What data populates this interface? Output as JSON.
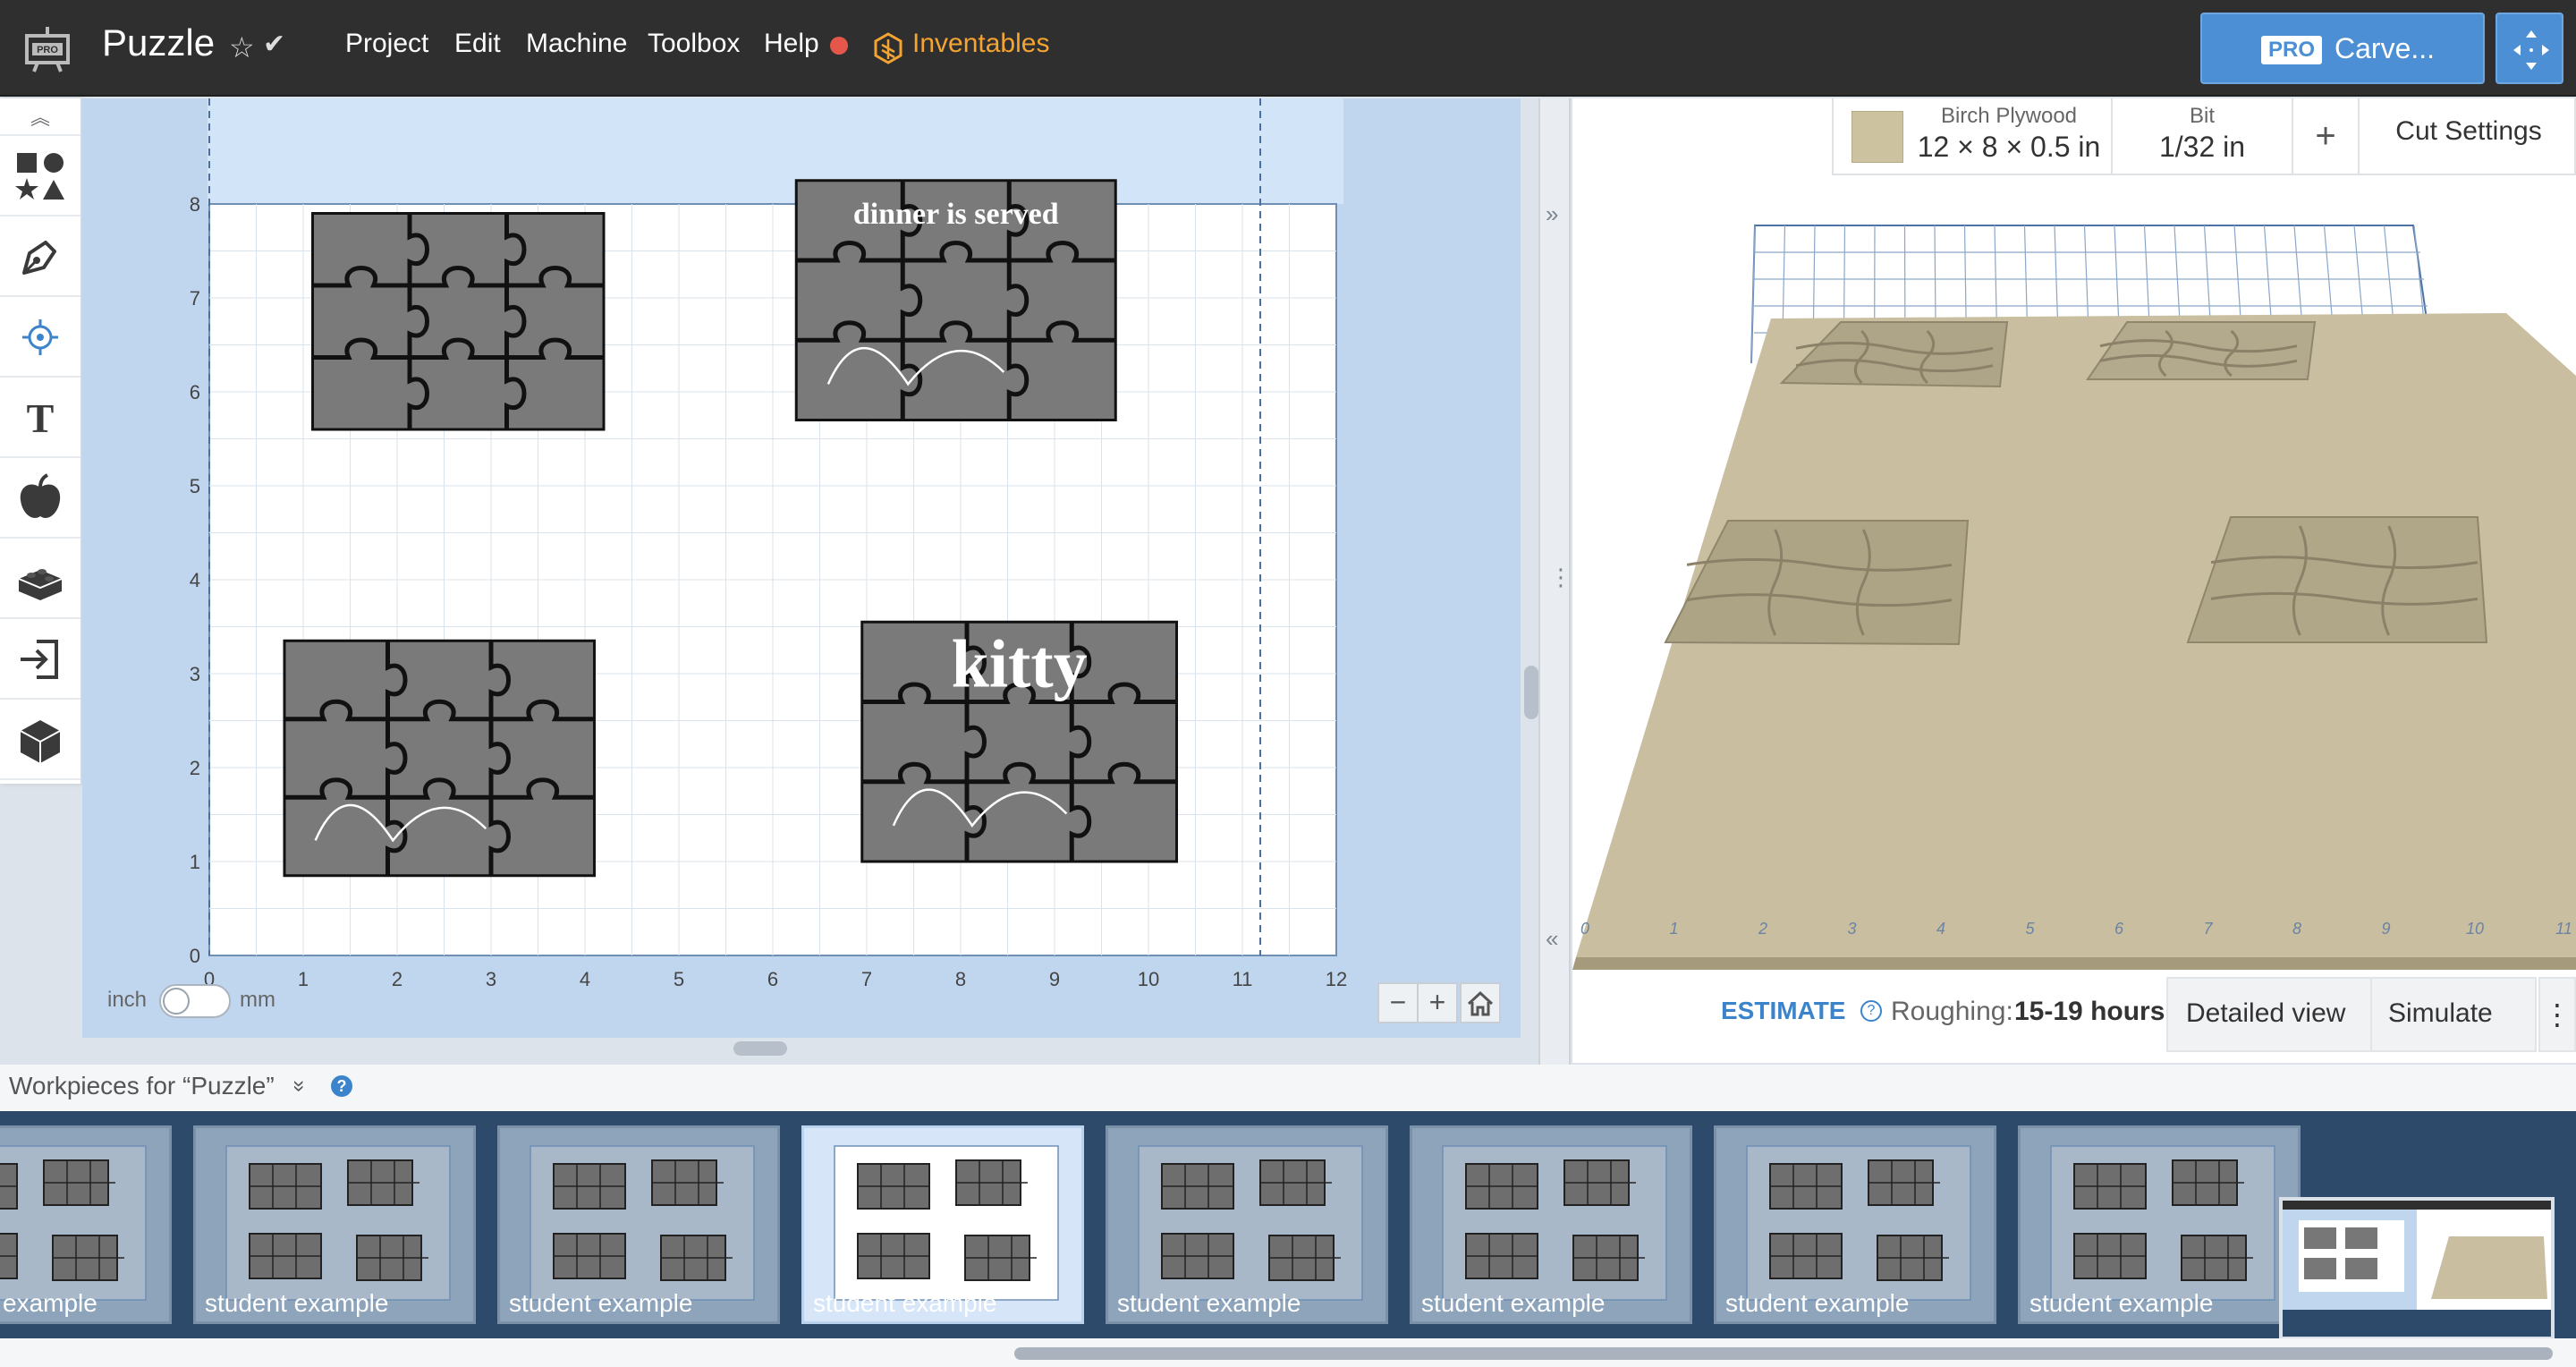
{
  "app": {
    "title": "Puzzle",
    "menu": [
      "Project",
      "Edit",
      "Machine",
      "Toolbox",
      "Help"
    ],
    "inventables_label": "Inventables",
    "carve_badge": "PRO",
    "carve_label": "Carve...",
    "icons": [
      "pro-logo-icon",
      "star-icon",
      "check-icon",
      "status-dot-icon",
      "inventables-logo-icon",
      "fullscreen-icon"
    ],
    "colors": {
      "topbar": "#2f2f2f",
      "accent": "#4d8fd4",
      "inventables": "#f4a432",
      "status_dot": "#e4574a"
    }
  },
  "tools": [
    {
      "name": "shapes-tool",
      "icon": "shapes-icon"
    },
    {
      "name": "pen-tool",
      "icon": "pen-icon"
    },
    {
      "name": "point-tool",
      "icon": "crosshair-icon"
    },
    {
      "name": "text-tool",
      "icon": "text-icon",
      "glyph": "T"
    },
    {
      "name": "icon-library-tool",
      "icon": "apple-icon"
    },
    {
      "name": "apps-tool",
      "icon": "brick-icon"
    },
    {
      "name": "import-tool",
      "icon": "import-icon"
    },
    {
      "name": "3d-tool",
      "icon": "cube-icon"
    }
  ],
  "canvas": {
    "x_ticks": [
      "0",
      "1",
      "2",
      "3",
      "4",
      "5",
      "6",
      "7",
      "8",
      "9",
      "10",
      "11",
      "12"
    ],
    "y_ticks": [
      "0",
      "1",
      "2",
      "3",
      "4",
      "5",
      "6",
      "7",
      "8"
    ],
    "units_left": "inch",
    "units_right": "mm",
    "puzzles": [
      {
        "id": "plain",
        "x": 1.1,
        "y": 5.6,
        "w": 3.1,
        "h": 2.3,
        "text": ""
      },
      {
        "id": "dinner",
        "x": 6.25,
        "y": 5.7,
        "w": 3.4,
        "h": 2.55,
        "text": "dinner is served"
      },
      {
        "id": "cats",
        "x": 0.8,
        "y": 0.85,
        "w": 3.3,
        "h": 2.5,
        "text": ""
      },
      {
        "id": "kitty",
        "x": 6.95,
        "y": 1.0,
        "w": 3.35,
        "h": 2.55,
        "text": "kitty"
      }
    ]
  },
  "material": {
    "name": "Birch Plywood",
    "dims": "12 × 8 × 0.5 in",
    "bit_label": "Bit",
    "bit_value": "1/32 in",
    "add_label": "+",
    "cut_settings": "Cut Settings",
    "swatch_color": "#cdc2a0"
  },
  "preview": {
    "axis_ticks": [
      "0",
      "1",
      "2",
      "3",
      "4",
      "5",
      "6",
      "7",
      "8",
      "9",
      "10",
      "11"
    ],
    "wood_color": "#c9bea0"
  },
  "estimate": {
    "label": "ESTIMATE",
    "roughing_label": "Roughing:",
    "roughing_value": "15-19 hours",
    "detailed_view": "Detailed view",
    "simulate": "Simulate",
    "more": "⋮"
  },
  "workpieces": {
    "title": "Workpieces for “Puzzle”",
    "chevron": "»",
    "help": "?",
    "items": [
      {
        "label": "example"
      },
      {
        "label": "student example"
      },
      {
        "label": "student example"
      },
      {
        "label": "student example",
        "active": true
      },
      {
        "label": "student example"
      },
      {
        "label": "student example"
      },
      {
        "label": "student example"
      },
      {
        "label": "student example"
      }
    ]
  }
}
